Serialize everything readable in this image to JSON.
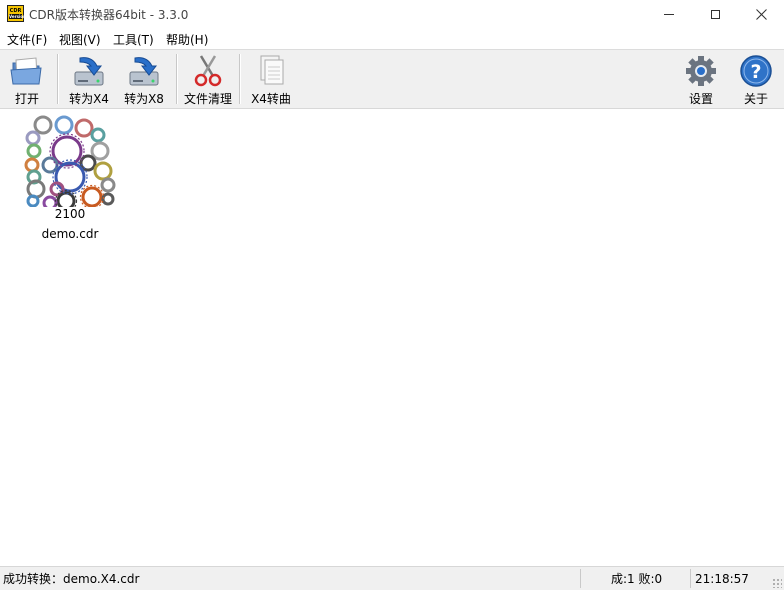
{
  "window": {
    "title": "CDR版本转换器64bit - 3.3.0",
    "icon_top": "CDR",
    "icon_bottom": "Version"
  },
  "menu": {
    "items": [
      {
        "label": "文件(F)"
      },
      {
        "label": "视图(V)"
      },
      {
        "label": "工具(T)"
      },
      {
        "label": "帮助(H)"
      }
    ]
  },
  "toolbar": {
    "open": "打开",
    "to_x4": "转为X4",
    "to_x8": "转为X8",
    "cleanup": "文件清理",
    "x4_curve": "X4转曲",
    "settings": "设置",
    "about": "关于"
  },
  "files": [
    {
      "name": "demo.cdr",
      "thumb_caption": "2100"
    }
  ],
  "status": {
    "message": "成功转换：demo.X4.cdr",
    "counts": "成:1 败:0",
    "time": "21:18:57"
  },
  "colors": {
    "toolbar_bg": "#f0f0f0",
    "accent_blue": "#2a6fc9",
    "scissors_red": "#d42a2a"
  }
}
